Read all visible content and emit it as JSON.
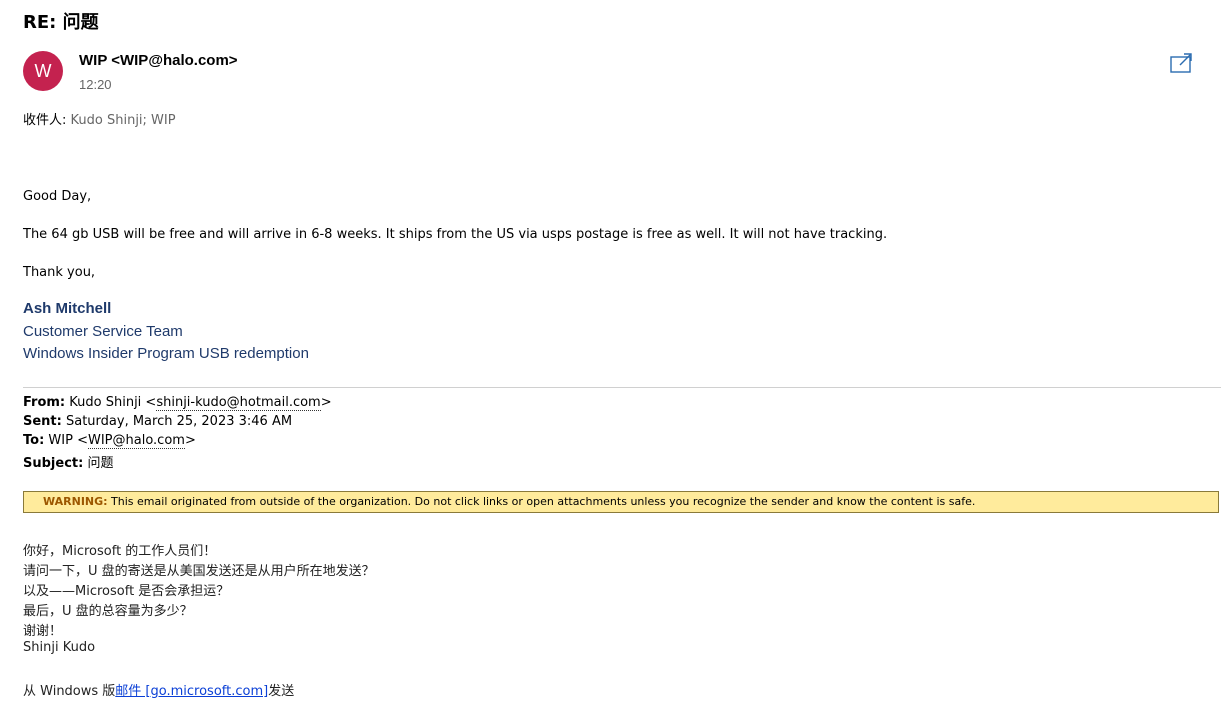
{
  "email": {
    "subject": "RE: 问题",
    "avatar_initial": "W",
    "sender": "WIP <WIP@halo.com>",
    "time": "12:20",
    "recipients_label": "收件人: ",
    "recipients": "Kudo Shinji; WIP",
    "popout_icon": "open-in-new-window-icon"
  },
  "body": {
    "greeting": "Good Day,",
    "line1": "The 64 gb USB will be free and will arrive in 6-8 weeks. It ships from the US via usps postage is free as well. It will not have tracking.",
    "closing": "Thank you,"
  },
  "signature": {
    "name": "Ash Mitchell",
    "team": "Customer Service Team",
    "program": "Windows Insider Program USB redemption"
  },
  "quoted_header": {
    "from_label": "From:",
    "from_name": " Kudo Shinji <",
    "from_addr": "shinji-kudo@hotmail.com",
    "from_end": ">",
    "sent_label": "Sent:",
    "sent_value": " Saturday, March 25, 2023 3:46 AM",
    "to_label": "To:",
    "to_name": " WIP <",
    "to_addr": "WIP@halo.com",
    "to_end": ">",
    "subject_label": "Subject:",
    "subject_value": " 问题"
  },
  "warning": {
    "label": "WARNING:",
    "text": " This email originated from outside of the organization. Do not click links or open attachments unless you recognize the sender and know the content is safe."
  },
  "original": {
    "l1": "你好，Microsoft 的工作人员们！",
    "l2": "请问一下，U 盘的寄送是从美国发送还是从用户所在地发送？",
    "l3": "以及——Microsoft 是否会承担运？",
    "l4": "最后，U 盘的总容量为多少？",
    "l5": "谢谢！",
    "l6": "Shinji Kudo",
    "footer_pre": "从 Windows 版",
    "footer_link": "邮件 [go.microsoft.com]",
    "footer_post": "发送"
  },
  "colors": {
    "avatar": "#c4224f",
    "signature": "#1f3a6b",
    "warning_bg": "#ffeb9c",
    "link": "#0a3fd6"
  }
}
